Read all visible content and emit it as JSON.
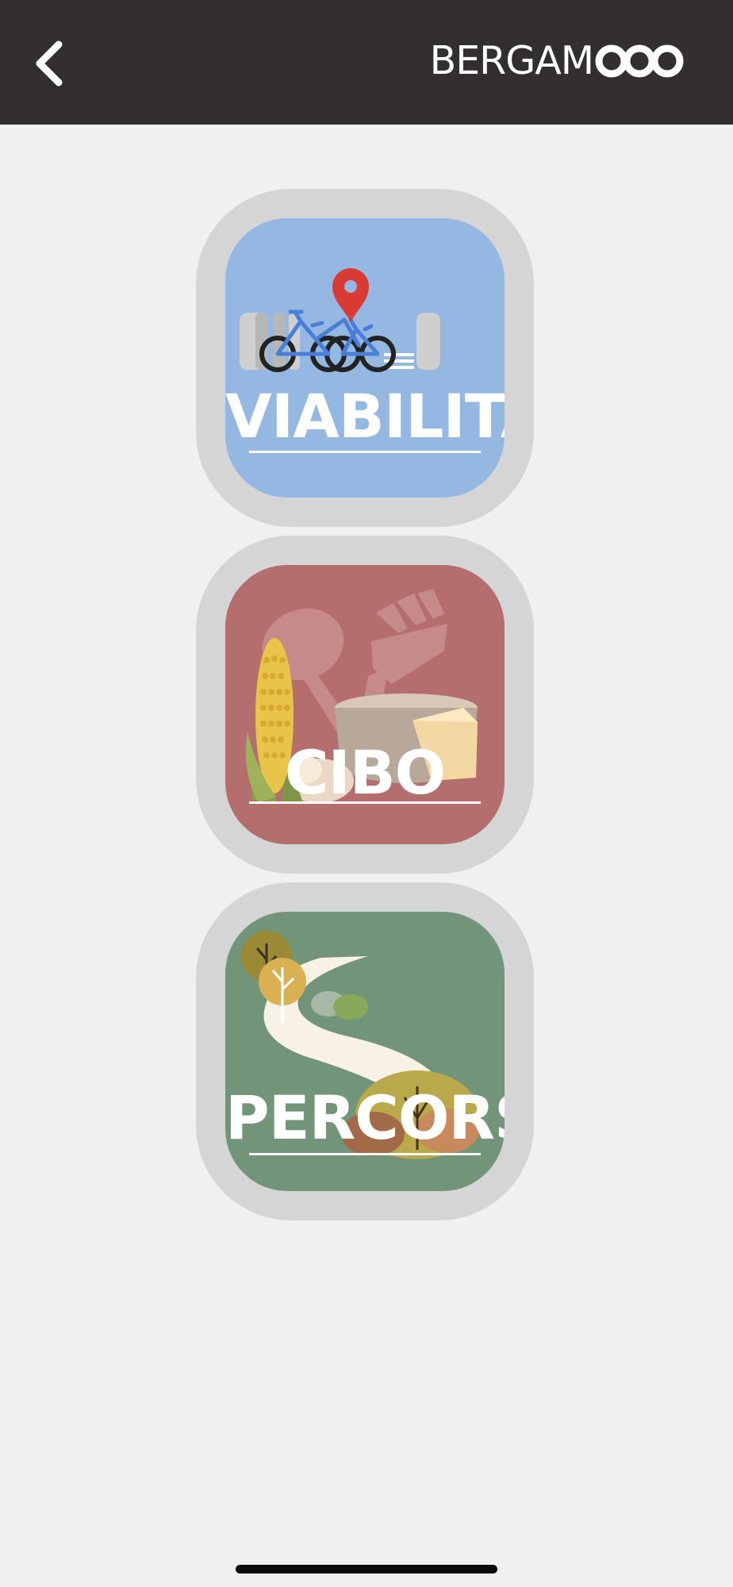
{
  "header": {
    "back_icon": "chevron-left-icon",
    "logo": {
      "text": "BERGAM",
      "rings_icon": "three-rings-icon"
    }
  },
  "categories": [
    {
      "label": "VIABILITA'",
      "bg": "#94b8e2",
      "icon": "bike-map-pin-illustration"
    },
    {
      "label": "CIBO",
      "bg": "#b46e6e",
      "icon": "food-illustration"
    },
    {
      "label": "PERCORSI",
      "bg": "#729479",
      "icon": "path-trees-illustration"
    }
  ],
  "colors": {
    "header_bg": "#322f2e",
    "page_bg": "#f0f0f0",
    "tile_border": "#d5d5d5",
    "pin": "#d93a34",
    "bike": "#4a7fd8"
  }
}
